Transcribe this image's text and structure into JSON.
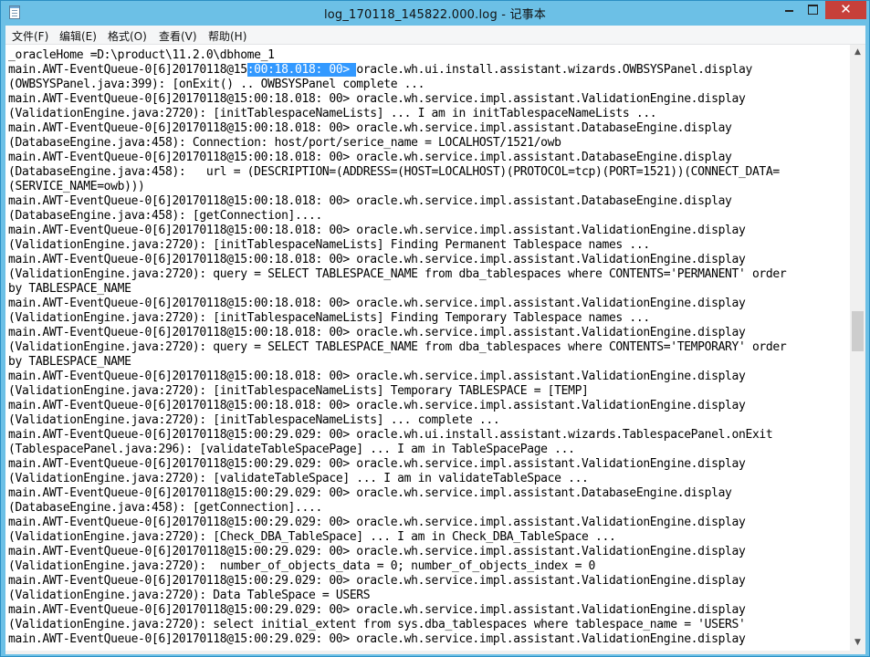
{
  "window": {
    "title": "log_170118_145822.000.log - 记事本",
    "minimize_label": "",
    "maximize_label": "",
    "close_label": "✕"
  },
  "menu": {
    "file": "文件(F)",
    "edit": "编辑(E)",
    "format": "格式(O)",
    "view": "查看(V)",
    "help": "帮助(H)"
  },
  "editor": {
    "selection": {
      "line_index": 1,
      "before": "main.AWT-EventQueue-0[6]20170118@15",
      "selected": ":00:18.018: 00> ",
      "after": "oracle.wh.ui.install.assistant.wizards.OWBSYSPanel.display"
    },
    "lines": [
      "_oracleHome =D:\\product\\11.2.0\\dbhome_1",
      "main.AWT-EventQueue-0[6]20170118@15:00:18.018: 00> oracle.wh.ui.install.assistant.wizards.OWBSYSPanel.display",
      "(OWBSYSPanel.java:399): [onExit() .. OWBSYSPanel complete ...",
      "main.AWT-EventQueue-0[6]20170118@15:00:18.018: 00> oracle.wh.service.impl.assistant.ValidationEngine.display",
      "(ValidationEngine.java:2720): [initTablespaceNameLists] ... I am in initTablespaceNameLists ...",
      "main.AWT-EventQueue-0[6]20170118@15:00:18.018: 00> oracle.wh.service.impl.assistant.DatabaseEngine.display",
      "(DatabaseEngine.java:458): Connection: host/port/serice_name = LOCALHOST/1521/owb",
      "main.AWT-EventQueue-0[6]20170118@15:00:18.018: 00> oracle.wh.service.impl.assistant.DatabaseEngine.display",
      "(DatabaseEngine.java:458):   url = (DESCRIPTION=(ADDRESS=(HOST=LOCALHOST)(PROTOCOL=tcp)(PORT=1521))(CONNECT_DATA=",
      "(SERVICE_NAME=owb)))",
      "main.AWT-EventQueue-0[6]20170118@15:00:18.018: 00> oracle.wh.service.impl.assistant.DatabaseEngine.display",
      "(DatabaseEngine.java:458): [getConnection]....",
      "main.AWT-EventQueue-0[6]20170118@15:00:18.018: 00> oracle.wh.service.impl.assistant.ValidationEngine.display",
      "(ValidationEngine.java:2720): [initTablespaceNameLists] Finding Permanent Tablespace names ...",
      "main.AWT-EventQueue-0[6]20170118@15:00:18.018: 00> oracle.wh.service.impl.assistant.ValidationEngine.display",
      "(ValidationEngine.java:2720): query = SELECT TABLESPACE_NAME from dba_tablespaces where CONTENTS='PERMANENT' order",
      "by TABLESPACE_NAME",
      "main.AWT-EventQueue-0[6]20170118@15:00:18.018: 00> oracle.wh.service.impl.assistant.ValidationEngine.display",
      "(ValidationEngine.java:2720): [initTablespaceNameLists] Finding Temporary Tablespace names ...",
      "main.AWT-EventQueue-0[6]20170118@15:00:18.018: 00> oracle.wh.service.impl.assistant.ValidationEngine.display",
      "(ValidationEngine.java:2720): query = SELECT TABLESPACE_NAME from dba_tablespaces where CONTENTS='TEMPORARY' order",
      "by TABLESPACE_NAME",
      "main.AWT-EventQueue-0[6]20170118@15:00:18.018: 00> oracle.wh.service.impl.assistant.ValidationEngine.display",
      "(ValidationEngine.java:2720): [initTablespaceNameLists] Temporary TABLESPACE = [TEMP]",
      "main.AWT-EventQueue-0[6]20170118@15:00:18.018: 00> oracle.wh.service.impl.assistant.ValidationEngine.display",
      "(ValidationEngine.java:2720): [initTablespaceNameLists] ... complete ...",
      "main.AWT-EventQueue-0[6]20170118@15:00:29.029: 00> oracle.wh.ui.install.assistant.wizards.TablespacePanel.onExit",
      "(TablespacePanel.java:296): [validateTableSpacePage] ... I am in TableSpacePage ...",
      "main.AWT-EventQueue-0[6]20170118@15:00:29.029: 00> oracle.wh.service.impl.assistant.ValidationEngine.display",
      "(ValidationEngine.java:2720): [validateTableSpace] ... I am in validateTableSpace ...",
      "main.AWT-EventQueue-0[6]20170118@15:00:29.029: 00> oracle.wh.service.impl.assistant.DatabaseEngine.display",
      "(DatabaseEngine.java:458): [getConnection]....",
      "main.AWT-EventQueue-0[6]20170118@15:00:29.029: 00> oracle.wh.service.impl.assistant.ValidationEngine.display",
      "(ValidationEngine.java:2720): [Check_DBA_TableSpace] ... I am in Check_DBA_TableSpace ...",
      "main.AWT-EventQueue-0[6]20170118@15:00:29.029: 00> oracle.wh.service.impl.assistant.ValidationEngine.display",
      "(ValidationEngine.java:2720):  number_of_objects_data = 0; number_of_objects_index = 0",
      "main.AWT-EventQueue-0[6]20170118@15:00:29.029: 00> oracle.wh.service.impl.assistant.ValidationEngine.display",
      "(ValidationEngine.java:2720): Data TableSpace = USERS",
      "main.AWT-EventQueue-0[6]20170118@15:00:29.029: 00> oracle.wh.service.impl.assistant.ValidationEngine.display",
      "(ValidationEngine.java:2720): select initial_extent from sys.dba_tablespaces where tablespace_name = 'USERS'",
      "main.AWT-EventQueue-0[6]20170118@15:00:29.029: 00> oracle.wh.service.impl.assistant.ValidationEngine.display"
    ]
  },
  "scrollbar": {
    "up_icon": "▲",
    "down_icon": "▼",
    "position_fraction": 0.47
  }
}
